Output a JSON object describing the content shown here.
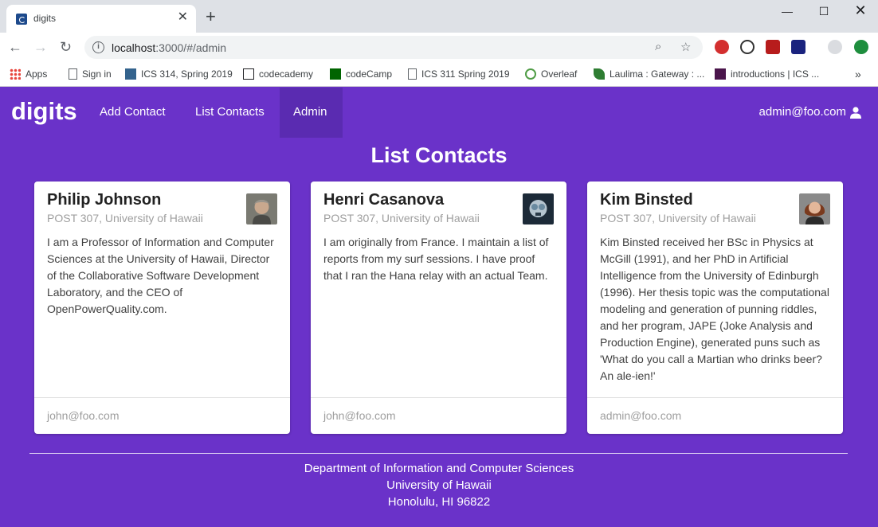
{
  "browser": {
    "tab_title": "digits",
    "url_host": "localhost",
    "url_rest": ":3000/#/admin",
    "bookmarks": [
      {
        "label": "Apps",
        "icon": "apps-grid-icon",
        "color": "#e8453c"
      },
      {
        "label": "Sign in",
        "icon": "page-icon",
        "color": "#5f6368"
      },
      {
        "label": "ICS 314, Spring 2019",
        "icon": "laulima-icon",
        "color": "#34638d"
      },
      {
        "label": "codecademy",
        "icon": "codecademy-icon",
        "color": "#202124"
      },
      {
        "label": "codeCamp",
        "icon": "codecamp-icon",
        "color": "#006400"
      },
      {
        "label": "ICS 311 Spring 2019",
        "icon": "page-icon",
        "color": "#5f6368"
      },
      {
        "label": "Overleaf",
        "icon": "overleaf-icon",
        "color": "#4f9c45"
      },
      {
        "label": "Laulima : Gateway : ...",
        "icon": "leaf-icon",
        "color": "#2e7d32"
      },
      {
        "label": "introductions | ICS ...",
        "icon": "slack-icon",
        "color": "#4a154b"
      }
    ]
  },
  "navbar": {
    "brand": "digits",
    "links": [
      "Add Contact",
      "List Contacts",
      "Admin"
    ],
    "user": "admin@foo.com"
  },
  "main": {
    "heading": "List Contacts",
    "contacts": [
      {
        "name": "Philip Johnson",
        "address": "POST 307, University of Hawaii",
        "description": "I am a Professor of Information and Computer Sciences at the University of Hawaii, Director of the Collaborative Software Development Laboratory, and the CEO of OpenPowerQuality.com.",
        "owner": "john@foo.com"
      },
      {
        "name": "Henri Casanova",
        "address": "POST 307, University of Hawaii",
        "description": "I am originally from France. I maintain a list of reports from my surf sessions. I have proof that I ran the Hana relay with an actual Team.",
        "owner": "john@foo.com"
      },
      {
        "name": "Kim Binsted",
        "address": "POST 307, University of Hawaii",
        "description": "Kim Binsted received her BSc in Physics at McGill (1991), and her PhD in Artificial Intelligence from the University of Edinburgh (1996). Her thesis topic was the computational modeling and generation of punning riddles, and her program, JAPE (Joke Analysis and Production Engine), generated puns such as 'What do you call a Martian who drinks beer? An ale-ien!'",
        "owner": "admin@foo.com"
      }
    ]
  },
  "footer": {
    "line1": "Department of Information and Computer Sciences",
    "line2": "University of Hawaii",
    "line3": "Honolulu, HI 96822"
  },
  "colors": {
    "brand_purple": "#6a32c9",
    "active_nav": "#5a2bb1"
  }
}
